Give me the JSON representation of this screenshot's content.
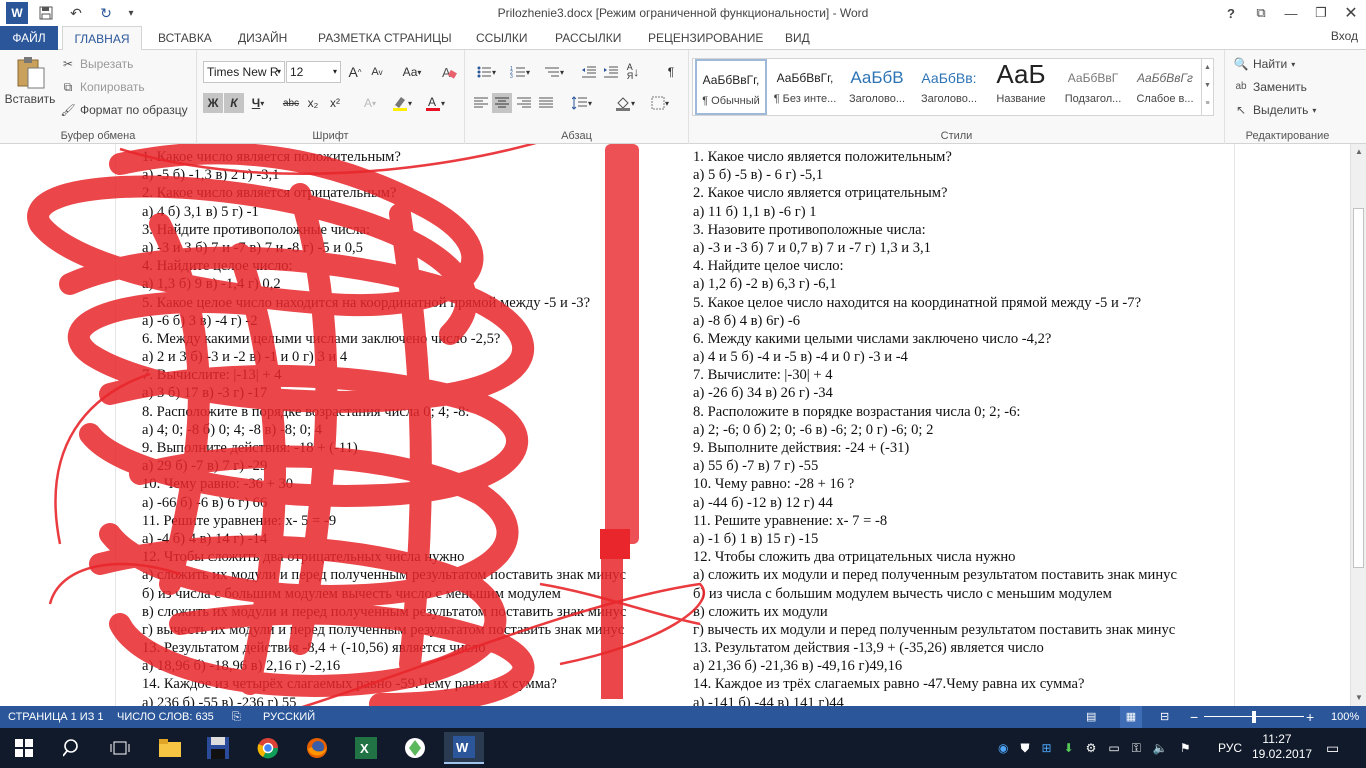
{
  "titlebar": {
    "title": "Prilozhenie3.docx [Режим ограниченной функциональности] - Word",
    "app_icon": "W",
    "help": "?",
    "buttons": [
      "restore-ribbon-icon",
      "minimize-icon",
      "maximize-icon",
      "close-icon"
    ]
  },
  "tabs": {
    "file": "ФАЙЛ",
    "items": [
      "ГЛАВНАЯ",
      "ВСТАВКА",
      "ДИЗАЙН",
      "РАЗМЕТКА СТРАНИЦЫ",
      "ССЫЛКИ",
      "РАССЫЛКИ",
      "РЕЦЕНЗИРОВАНИЕ",
      "ВИД"
    ],
    "signin": "Вход"
  },
  "ribbon": {
    "clipboard": {
      "paste": "Вставить",
      "cut": "Вырезать",
      "copy": "Копировать",
      "format_painter": "Формат по образцу",
      "label": "Буфер обмена"
    },
    "font": {
      "name": "Times New R",
      "size": "12",
      "bold": "Ж",
      "italic": "К",
      "underline": "Ч",
      "strike": "abc",
      "sub": "x₂",
      "sup": "x²",
      "case": "Аа",
      "grow": "A",
      "shrink": "A",
      "label": "Шрифт"
    },
    "paragraph": {
      "label": "Абзац"
    },
    "styles": {
      "label": "Стили",
      "items": [
        {
          "sample": "АаБбВвГг,",
          "name": "¶ Обычный"
        },
        {
          "sample": "АаБбВвГг,",
          "name": "¶ Без инте..."
        },
        {
          "sample": "АаБбВ",
          "name": "Заголово..."
        },
        {
          "sample": "АаБбВв:",
          "name": "Заголово..."
        },
        {
          "sample": "АаБ",
          "name": "Название"
        },
        {
          "sample": "АаБбВвГ",
          "name": "Подзагол..."
        },
        {
          "sample": "АаБбВвГг",
          "name": "Слабое в..."
        }
      ]
    },
    "editing": {
      "find": "Найти",
      "replace": "Заменить",
      "select": "Выделить",
      "label": "Редактирование"
    }
  },
  "document": {
    "left_column": [
      "1. Какое число является положительным?",
      "а) -5 б) -1,3 в) 2 г) -3,1",
      "2. Какое число является отрицательным?",
      "а) 4 б) 3,1 в) 5 г) -1",
      "3. Найдите противоположные числа:",
      "а) -3 и 3 б) 7 и -7 в) 7 и -8 г) -5 и 0,5",
      "4. Найдите целое число:",
      "а) 1,3 б) 9 в) -1,4 г) 0,2",
      "5. Какое целое число находится на координатной прямой между -5 и -3?",
      "а) -6 б) 3 в) -4 г) -2",
      "6. Между какими целыми числами заключено число -2,5?",
      "а) 2 и 3 б) -3 и -2 в) -1 и 0 г) 3 и 4",
      "7. Вычислите: |-13| + 4",
      "а) 3 б) 17 в) -3 г) -17",
      "8. Расположите в порядке возрастания числа 0; 4; -8:",
      "а) 4; 0; -8 б) 0; 4; -8 в) -8; 0; 4",
      "9. Выполните действия: -18 + (-11)",
      "а) 29 б) -7 в) 7 г) -29",
      "10. Чему равно: -36 + 30",
      "а) -66 б) -6 в) 6 г) 66",
      "11. Решите уравнение: х- 5 = -9",
      "а) -4 б) 4 в) 14 г) -14",
      "12. Чтобы сложить два отрицательных числа нужно",
      "а) сложить их модули и перед полученным результатом поставить знак минус",
      "б) из числа с большим модулем вычесть число с меньшим модулем",
      "в) сложить их модули и перед полученным результатом поставить знак минус",
      "г) вычесть их модули и перед полученным результатом поставить знак минус",
      "13. Результатом действия -8,4 + (-10,56) является число",
      "а) 18,96 б) -18,96 в) 2,16 г) -2,16",
      "14. Каждое из четырёх слагаемых равно -59.Чему равна их сумма?",
      "а) 236 б) -55 в) -236 г) 55"
    ],
    "right_column": [
      "1. Какое число является положительным?",
      "а) 5 б) -5 в) - 6     г) -5,1",
      "2. Какое число является отрицательным?",
      "а) 11 б) 1,1 в) -6          г) 1",
      "3. Назовите противоположные числа:",
      "а) -3 и -3     б) 7 и  0,7     в) 7 и -7 г) 1,3 и 3,1",
      "4. Найдите целое число:",
      "а) 1,2  б) -2  в) 6,3       г) -6,1",
      "5. Какое целое число находится на координатной прямой между -5 и -7?",
      "а) -8 б) 4 в) 6г) -6",
      "6. Между какими целыми числами заключено число -4,2?",
      "а) 4 и 5 б) -4 и -5 в) -4 и 0 г) -3 и -4",
      "7. Вычислите: |-30| + 4",
      "а) -26  б) 34  в) 26  г) -34",
      "8. Расположите в порядке возрастания числа 0; 2; -6:",
      "а) 2; -6; 0      б) 2; 0; -6         в) -6; 2; 0      г) -6; 0; 2",
      "9. Выполните действия:     -24 + (-31)",
      "а) 55 б) -7 в) 7 г) -55",
      "10. Чему равно: -28 + 16 ?",
      "а) -44   б) -12   в) 12     г) 44",
      "11. Решите уравнение: х- 7 = -8",
      "а) -1   б) 1   в) 15    г) -15",
      "12.  Чтобы сложить два отрицательных числа нужно",
      "а) сложить их модули  и перед полученным результатом поставить знак минус",
      "б) из числа с большим модулем вычесть число с меньшим модулем",
      "в) сложить их модули",
      "г)  вычесть их модули и перед полученным результатом поставить знак минус",
      "13. Результатом действия      -13,9 + (-35,26) является число",
      "а) 21,36          б) -21,36          в) -49,16       г)49,16",
      "14. Каждое из трёх слагаемых равно -47.Чему равна их сумма?",
      "а) -141          б) -44            в) 141       г)44"
    ]
  },
  "status": {
    "page": "СТРАНИЦА 1 ИЗ 1",
    "words": "ЧИСЛО СЛОВ: 635",
    "language": "РУССКИЙ",
    "zoom": "100%",
    "zoom_level": 0.5,
    "minus": "−",
    "plus": "+"
  },
  "taskbar": {
    "lang": "РУС",
    "time": "11:27",
    "date": "19.02.2017",
    "apps": [
      "start-icon",
      "search-icon",
      "task-view-icon",
      "file-explorer-icon",
      "save-disk-icon",
      "chrome-icon",
      "firefox-icon",
      "excel-icon",
      "gem-icon",
      "word-icon"
    ]
  },
  "colors": {
    "accent": "#2b579a",
    "taskbar": "#101a2a",
    "scribble": "#e8262b"
  }
}
